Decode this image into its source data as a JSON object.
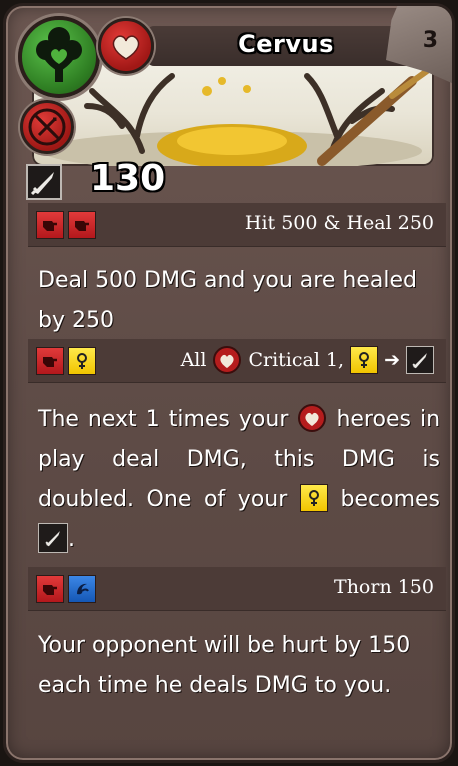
{
  "card": {
    "name": "Cervus",
    "level": "3",
    "attack": "130",
    "colors": {
      "family_green": "#3a9a2b",
      "red": "#c62127",
      "yellow": "#f5d000",
      "blue": "#1e66c8",
      "panel": "#4c3b37"
    }
  },
  "icons": {
    "family": "tree-heart-icon",
    "type": "heart-icon",
    "status": "no-attack-icon",
    "attack": "sword-icon"
  },
  "abilities": [
    {
      "icons": [
        "fist-icon",
        "fist-icon"
      ],
      "name": "Hit 500 & Heal 250",
      "description": "Deal 500 DMG and you are healed by 250"
    },
    {
      "icons": [
        "fist-icon",
        "gender-icon"
      ],
      "name_parts": {
        "all": "All",
        "critical": "Critical 1,",
        "arrow": "➔"
      },
      "description_parts": {
        "p1": "The next 1 times your",
        "p2": "heroes in play deal DMG, this DMG is doubled. One of your",
        "p3": "becomes",
        "p4": "."
      }
    },
    {
      "icons": [
        "fist-icon",
        "shield-swirl-icon"
      ],
      "name": "Thorn 150",
      "description": "Your opponent will be hurt by 150 each time he deals DMG to you."
    }
  ]
}
